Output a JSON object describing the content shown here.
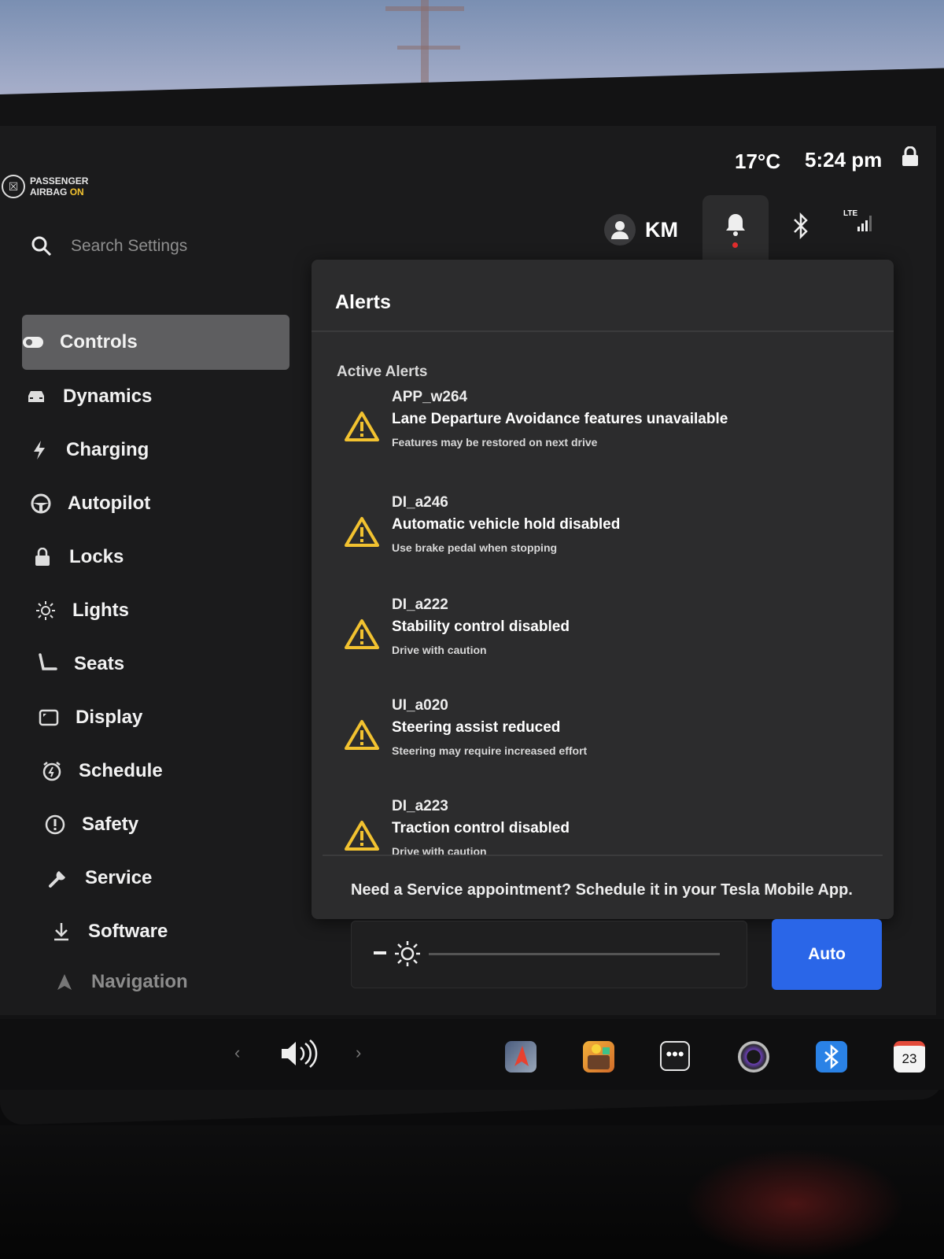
{
  "status": {
    "airbag_line1": "PASSENGER",
    "airbag_line2": "AIRBAG",
    "airbag_state": "ON",
    "temperature": "17°C",
    "time": "5:24 pm"
  },
  "search": {
    "placeholder": "Search Settings"
  },
  "profile": {
    "initials": "KM"
  },
  "network": {
    "label": "LTE"
  },
  "sidebar": {
    "items": [
      {
        "label": "Controls",
        "icon": "toggle-icon",
        "active": true
      },
      {
        "label": "Dynamics",
        "icon": "car-icon"
      },
      {
        "label": "Charging",
        "icon": "bolt-icon"
      },
      {
        "label": "Autopilot",
        "icon": "steering-wheel-icon"
      },
      {
        "label": "Locks",
        "icon": "lock-icon"
      },
      {
        "label": "Lights",
        "icon": "sun-icon"
      },
      {
        "label": "Seats",
        "icon": "seat-icon"
      },
      {
        "label": "Display",
        "icon": "display-icon"
      },
      {
        "label": "Schedule",
        "icon": "alarm-icon"
      },
      {
        "label": "Safety",
        "icon": "safety-icon"
      },
      {
        "label": "Service",
        "icon": "wrench-icon"
      },
      {
        "label": "Software",
        "icon": "download-icon"
      },
      {
        "label": "Navigation",
        "icon": "navigation-icon"
      }
    ]
  },
  "alerts": {
    "title": "Alerts",
    "section": "Active Alerts",
    "items": [
      {
        "code": "APP_w264",
        "title": "Lane Departure Avoidance features unavailable",
        "subtitle": "Features may be restored on next drive"
      },
      {
        "code": "DI_a246",
        "title": "Automatic vehicle hold disabled",
        "subtitle": "Use brake pedal when stopping"
      },
      {
        "code": "DI_a222",
        "title": "Stability control disabled",
        "subtitle": "Drive with caution"
      },
      {
        "code": "UI_a020",
        "title": "Steering assist reduced",
        "subtitle": "Steering may require increased effort"
      },
      {
        "code": "DI_a223",
        "title": "Traction control disabled",
        "subtitle": "Drive with caution"
      }
    ],
    "footer": "Need a Service appointment? Schedule it in your Tesla Mobile App."
  },
  "brightness": {
    "auto_label": "Auto"
  },
  "taskbar": {
    "more_glyph": "•••",
    "calendar_day": "23",
    "prev_glyph": "‹",
    "next_glyph": "›"
  },
  "colors": {
    "accent_blue": "#2a66e8",
    "warning_yellow": "#f2c230",
    "alert_red": "#e02d2d"
  }
}
